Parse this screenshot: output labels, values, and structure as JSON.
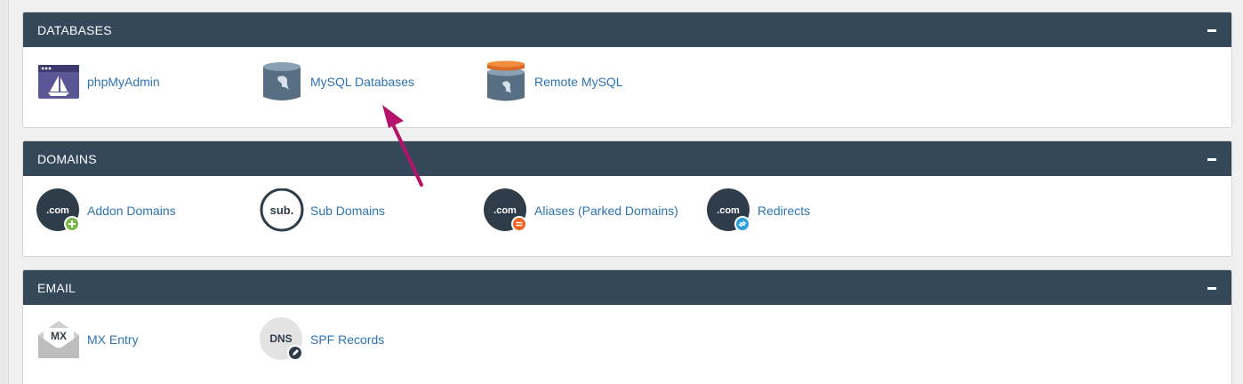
{
  "sections": {
    "databases": {
      "title": "DATABASES",
      "items": [
        {
          "label": "phpMyAdmin",
          "icon": "phpmyadmin-icon"
        },
        {
          "label": "MySQL Databases",
          "icon": "mysql-database-icon"
        },
        {
          "label": "Remote MySQL",
          "icon": "remote-mysql-icon"
        }
      ]
    },
    "domains": {
      "title": "DOMAINS",
      "items": [
        {
          "label": "Addon Domains",
          "icon": "addon-domain-icon"
        },
        {
          "label": "Sub Domains",
          "icon": "subdomain-icon"
        },
        {
          "label": "Aliases (Parked Domains)",
          "icon": "alias-domain-icon"
        },
        {
          "label": "Redirects",
          "icon": "redirect-domain-icon"
        }
      ]
    },
    "email": {
      "title": "EMAIL",
      "items": [
        {
          "label": "MX Entry",
          "icon": "mx-entry-icon"
        },
        {
          "label": "SPF Records",
          "icon": "spf-dns-icon"
        }
      ]
    }
  },
  "icon_text": {
    "com": ".com",
    "sub": "sub.",
    "mx": "MX",
    "dns": "DNS"
  },
  "colors": {
    "header_bg": "#34485a",
    "link": "#2d73b3",
    "annotation_arrow": "#b5136b",
    "badge_add": "#7ab648",
    "badge_alias": "#f26522",
    "badge_redirect": "#2d9fd9"
  }
}
